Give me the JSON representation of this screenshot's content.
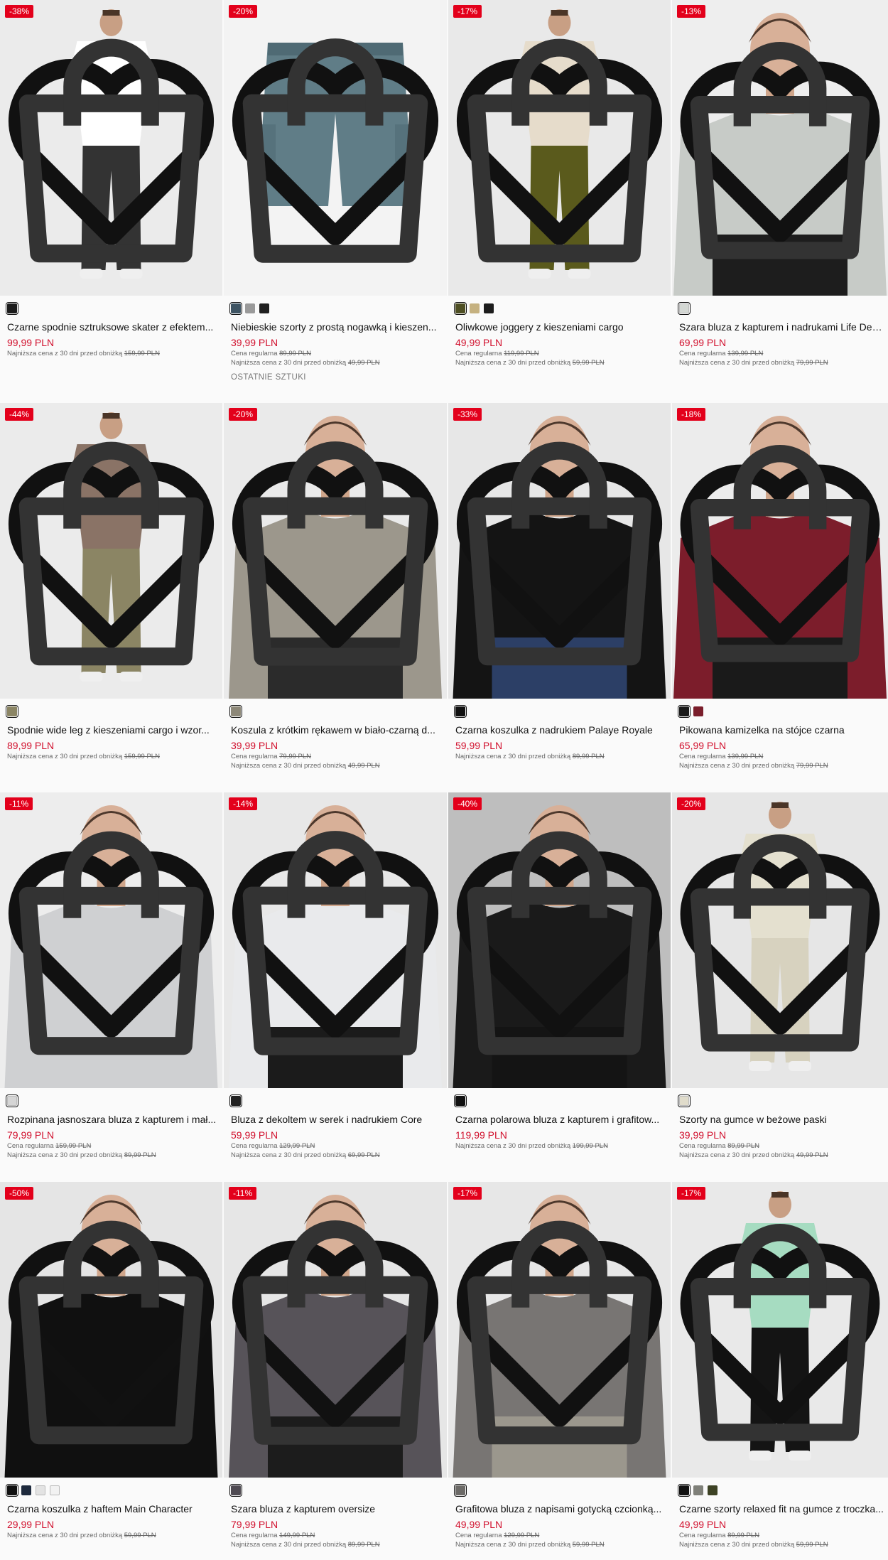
{
  "products": [
    {
      "badge": "-38%",
      "name": "Czarne spodnie sztruksowe skater z efektem...",
      "price": "99,99 PLN",
      "lowest_label": "Najniższa cena z 30 dni przed obniżką",
      "lowest_price": "159,99 PLN",
      "swatches": [
        "#1c1c1c"
      ],
      "photo": {
        "bg": "#ebebeb",
        "top": "#ffffff",
        "bottom": "#333333",
        "type": "full"
      }
    },
    {
      "badge": "-20%",
      "name": "Niebieskie szorty z prostą nogawką i kieszen...",
      "price": "39,99 PLN",
      "regular_label": "Cena regularna",
      "regular_price": "89,99 PLN",
      "lowest_label": "Najniższa cena z 30 dni przed obniżką",
      "lowest_price": "49,99 PLN",
      "note": "OSTATNIE SZTUKI",
      "swatches": [
        "#3e5463",
        "#9a9a9a",
        "#1f1f1f"
      ],
      "photo": {
        "bg": "#f3f3f3",
        "top": "#607d87",
        "bottom": "#607d87",
        "type": "shorts"
      }
    },
    {
      "badge": "-17%",
      "name": "Oliwkowe joggery z kieszeniami cargo",
      "price": "49,99 PLN",
      "regular_label": "Cena regularna",
      "regular_price": "119,99 PLN",
      "lowest_label": "Najniższa cena z 30 dni przed obniżką",
      "lowest_price": "59,99 PLN",
      "swatches": [
        "#4e4f23",
        "#c5b180",
        "#1c1c1c"
      ],
      "photo": {
        "bg": "#e9e9e9",
        "top": "#e6dccb",
        "bottom": "#5a5a1c",
        "type": "full"
      }
    },
    {
      "badge": "-13%",
      "name": "Szara bluza z kapturem i nadrukami Life Des...",
      "price": "69,99 PLN",
      "regular_label": "Cena regularna",
      "regular_price": "139,99 PLN",
      "lowest_label": "Najniższa cena z 30 dni przed obniżką",
      "lowest_price": "79,99 PLN",
      "swatches": [
        "#d4d8d4"
      ],
      "photo": {
        "bg": "#eeeeee",
        "top": "#c7cbc7",
        "bottom": "#1d1d1d",
        "type": "close"
      }
    },
    {
      "badge": "-44%",
      "name": "Spodnie wide leg z kieszeniami cargo i wzor...",
      "price": "89,99 PLN",
      "lowest_label": "Najniższa cena z 30 dni przed obniżką",
      "lowest_price": "159,99 PLN",
      "swatches": [
        "#8b8564"
      ],
      "photo": {
        "bg": "#ebebeb",
        "top": "#8a7366",
        "bottom": "#8b8564",
        "type": "full"
      }
    },
    {
      "badge": "-20%",
      "name": "Koszula z krótkim rękawem w biało-czarną d...",
      "price": "39,99 PLN",
      "regular_label": "Cena regularna",
      "regular_price": "79,99 PLN",
      "lowest_label": "Najniższa cena z 30 dni przed obniżką",
      "lowest_price": "49,99 PLN",
      "swatches": [
        "#8d8878"
      ],
      "photo": {
        "bg": "#eaeaea",
        "top": "#9c978c",
        "bottom": "#2b2b2b",
        "type": "close"
      }
    },
    {
      "badge": "-33%",
      "name": "Czarna koszulka z nadrukiem Palaye Royale",
      "price": "59,99 PLN",
      "lowest_label": "Najniższa cena z 30 dni przed obniżką",
      "lowest_price": "89,99 PLN",
      "swatches": [
        "#111111"
      ],
      "photo": {
        "bg": "#e7e7e7",
        "top": "#141414",
        "bottom": "#2c3f66",
        "type": "close"
      }
    },
    {
      "badge": "-18%",
      "name": "Pikowana kamizelka na stójce czarna",
      "price": "65,99 PLN",
      "regular_label": "Cena regularna",
      "regular_price": "139,99 PLN",
      "lowest_label": "Najniższa cena z 30 dni przed obniżką",
      "lowest_price": "79,99 PLN",
      "swatches": [
        "#1a1a1a",
        "#7a1e2b"
      ],
      "photo": {
        "bg": "#ececec",
        "top": "#7c1d2b",
        "bottom": "#1a1a1a",
        "type": "close"
      }
    },
    {
      "badge": "-11%",
      "name": "Rozpinana jasnoszara bluza z kapturem i mał...",
      "price": "79,99 PLN",
      "regular_label": "Cena regularna",
      "regular_price": "159,99 PLN",
      "lowest_label": "Najniższa cena z 30 dni przed obniżką",
      "lowest_price": "89,99 PLN",
      "swatches": [
        "#d5d5d5"
      ],
      "photo": {
        "bg": "#ededed",
        "top": "#cfd0d2",
        "bottom": "#cfd0d2",
        "type": "close"
      }
    },
    {
      "badge": "-14%",
      "name": "Bluza z dekoltem w serek i nadrukiem Core",
      "price": "59,99 PLN",
      "regular_label": "Cena regularna",
      "regular_price": "129,99 PLN",
      "lowest_label": "Najniższa cena z 30 dni przed obniżką",
      "lowest_price": "69,99 PLN",
      "swatches": [
        "#222222"
      ],
      "photo": {
        "bg": "#e8e8e8",
        "top": "#e9eaec",
        "bottom": "#1b1b1b",
        "type": "close"
      }
    },
    {
      "badge": "-40%",
      "name": "Czarna polarowa bluza z kapturem i grafitow...",
      "price": "119,99 PLN",
      "lowest_label": "Najniższa cena z 30 dni przed obniżką",
      "lowest_price": "199,99 PLN",
      "swatches": [
        "#111111"
      ],
      "photo": {
        "bg": "#bebebe",
        "top": "#1a1a1a",
        "bottom": "#141414",
        "type": "close"
      }
    },
    {
      "badge": "-20%",
      "name": "Szorty na gumce w beżowe paski",
      "price": "39,99 PLN",
      "regular_label": "Cena regularna",
      "regular_price": "89,99 PLN",
      "lowest_label": "Najniższa cena z 30 dni przed obniżką",
      "lowest_price": "49,99 PLN",
      "swatches": [
        "#e0dccb"
      ],
      "photo": {
        "bg": "#e6e6e6",
        "top": "#e4e0cf",
        "bottom": "#d7d2bf",
        "type": "full"
      }
    },
    {
      "badge": "-50%",
      "name": "Czarna koszulka z haftem Main Character",
      "price": "29,99 PLN",
      "lowest_label": "Najniższa cena z 30 dni przed obniżką",
      "lowest_price": "59,99 PLN",
      "swatches": [
        "#111111",
        "#1e2a3d",
        "#e3e3e3",
        "#f2f2f2"
      ],
      "photo": {
        "bg": "#e5e5e5",
        "top": "#101010",
        "bottom": "#101010",
        "type": "close"
      }
    },
    {
      "badge": "-11%",
      "name": "Szara bluza z kapturem oversize",
      "price": "79,99 PLN",
      "regular_label": "Cena regularna",
      "regular_price": "149,99 PLN",
      "lowest_label": "Najniższa cena z 30 dni przed obniżką",
      "lowest_price": "89,99 PLN",
      "swatches": [
        "#4f4a52"
      ],
      "photo": {
        "bg": "#e6e6e6",
        "top": "#575359",
        "bottom": "#1c1c1c",
        "type": "close"
      }
    },
    {
      "badge": "-17%",
      "name": "Grafitowa bluza z napisami gotycką czcionką...",
      "price": "49,99 PLN",
      "regular_label": "Cena regularna",
      "regular_price": "129,99 PLN",
      "lowest_label": "Najniższa cena z 30 dni przed obniżką",
      "lowest_price": "59,99 PLN",
      "swatches": [
        "#6c6a67"
      ],
      "photo": {
        "bg": "#e7e7e7",
        "top": "#787573",
        "bottom": "#9b978d",
        "type": "close"
      }
    },
    {
      "badge": "-17%",
      "name": "Czarne szorty relaxed fit na gumce z troczka...",
      "price": "49,99 PLN",
      "regular_label": "Cena regularna",
      "regular_price": "89,99 PLN",
      "lowest_label": "Najniższa cena z 30 dni przed obniżką",
      "lowest_price": "59,99 PLN",
      "swatches": [
        "#111111",
        "#7f8079",
        "#3d4224"
      ],
      "photo": {
        "bg": "#e9e9e9",
        "top": "#a6dcc1",
        "bottom": "#141414",
        "type": "full"
      }
    }
  ]
}
